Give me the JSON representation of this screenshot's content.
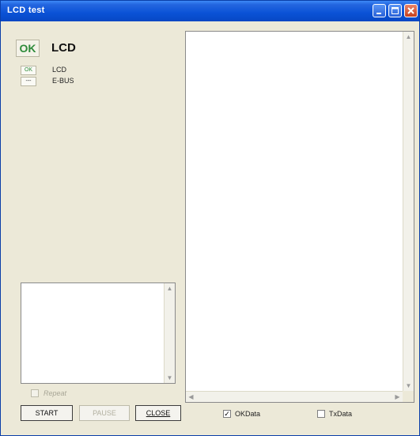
{
  "window": {
    "title": "LCD test"
  },
  "status": {
    "main_badge": "OK",
    "main_label": "LCD",
    "items": [
      {
        "badge": "OK",
        "label": "LCD"
      },
      {
        "badge": "---",
        "label": "E-BUS"
      }
    ]
  },
  "options": {
    "repeat_label": "Repeat",
    "repeat_checked": false,
    "repeat_enabled": false
  },
  "buttons": {
    "start": "START",
    "pause": "PAUSE",
    "close": "CLOSE"
  },
  "data_panel": {
    "okdata_label": "OKData",
    "okdata_checked": true,
    "txdata_label": "TxData",
    "txdata_checked": false
  },
  "colors": {
    "titlebar": "#0a52d6",
    "ok_green": "#2e8b3a",
    "background": "#ece9d8"
  }
}
